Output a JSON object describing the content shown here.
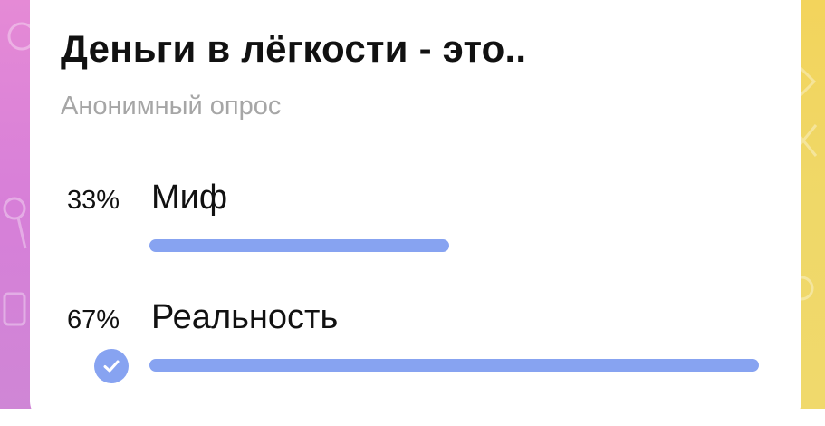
{
  "poll": {
    "question": "Деньги в лёгкости - это..",
    "type_label": "Анонимный опрос",
    "options": [
      {
        "label": "Миф",
        "percent_text": "33%",
        "percent": 33,
        "selected": false
      },
      {
        "label": "Реальность",
        "percent_text": "67%",
        "percent": 67,
        "selected": true
      }
    ]
  },
  "colors": {
    "accent": "#87a3f1",
    "bg_left": "#e58ad6",
    "bg_right": "#f3d45c",
    "subtitle": "#a6a6a6"
  },
  "icons": {
    "selected": "check-circle-icon"
  }
}
